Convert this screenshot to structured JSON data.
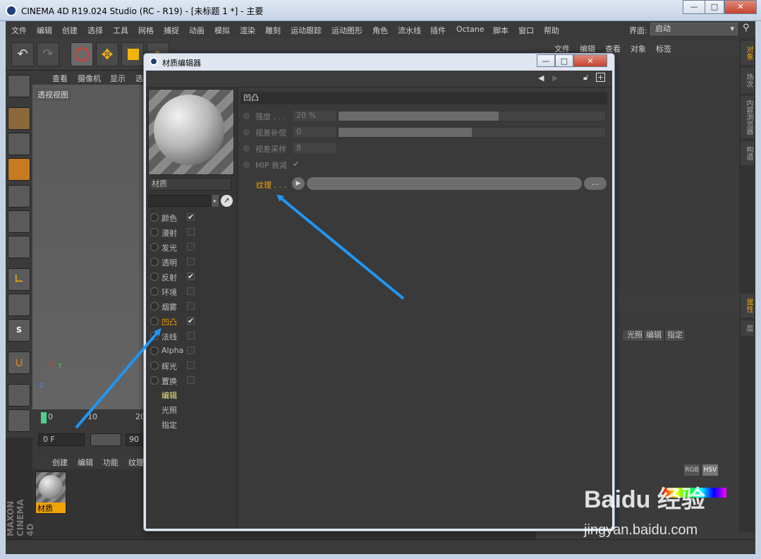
{
  "window": {
    "title": "CINEMA 4D R19.024 Studio (RC - R19) - [未标题 1 *] - 主要",
    "min": "—",
    "max": "□",
    "close": "✕"
  },
  "menu": [
    "文件",
    "编辑",
    "创建",
    "选择",
    "工具",
    "网格",
    "捕捉",
    "动画",
    "模拟",
    "渲染",
    "雕刻",
    "运动跟踪",
    "运动图形",
    "角色",
    "流水线",
    "插件",
    "Octane",
    "脚本",
    "窗口",
    "帮助"
  ],
  "layout": {
    "label": "界面:",
    "value": "启动"
  },
  "viewport": {
    "menu": [
      "查看",
      "摄像机",
      "显示",
      "选"
    ],
    "label": "透视视图"
  },
  "timeline": {
    "frame_start": "0",
    "tick1": "10",
    "tick2": "20",
    "current": "0 F",
    "end": "90"
  },
  "materials": {
    "menu": [
      "创建",
      "编辑",
      "功能",
      "纹理"
    ],
    "item": "材质"
  },
  "brand": {
    "maxon": "MAXON",
    "product": "CINEMA 4D"
  },
  "objects": {
    "menu": [
      "文件",
      "编辑",
      "查看",
      "对象",
      "标签"
    ]
  },
  "right_tabs": [
    "对象",
    "场次",
    "内容浏览器",
    "构造",
    "属性",
    "层"
  ],
  "attributes": {
    "tabs": [
      "光照",
      "编辑",
      "指定"
    ],
    "color_modes": [
      "RGB",
      "HSV"
    ]
  },
  "dialog": {
    "title": "材质编辑器",
    "material_name": "材质",
    "channels": [
      {
        "label": "颜色",
        "checked": true,
        "active": false
      },
      {
        "label": "漫射",
        "checked": false,
        "active": false
      },
      {
        "label": "发光",
        "checked": false,
        "active": false
      },
      {
        "label": "透明",
        "checked": false,
        "active": false
      },
      {
        "label": "反射",
        "checked": true,
        "active": false
      },
      {
        "label": "环境",
        "checked": false,
        "active": false
      },
      {
        "label": "烟雾",
        "checked": false,
        "active": false
      },
      {
        "label": "凹凸",
        "checked": true,
        "active": true
      },
      {
        "label": "法线",
        "checked": false,
        "active": false
      },
      {
        "label": "Alpha",
        "checked": false,
        "active": false
      },
      {
        "label": "辉光",
        "checked": false,
        "active": false
      },
      {
        "label": "置换",
        "checked": false,
        "active": false
      }
    ],
    "sub_items": [
      "编辑",
      "光照",
      "指定"
    ],
    "section": "凹凸",
    "params": [
      {
        "label": "强度 . . .",
        "value": "20 %",
        "fill": 0.6
      },
      {
        "label": "视差补偿",
        "value": "0",
        "fill": 0.5
      },
      {
        "label": "视差采样",
        "value": "8"
      },
      {
        "label": "MIP 衰减",
        "value": "✔"
      }
    ],
    "texture": {
      "label": "纹理 . . .",
      "more": "..."
    }
  },
  "watermark": {
    "logo": "Baidu 经验",
    "url": "jingyan.baidu.com"
  },
  "colors": {
    "accent": "#f0a30a",
    "arrow": "#2196f3"
  }
}
